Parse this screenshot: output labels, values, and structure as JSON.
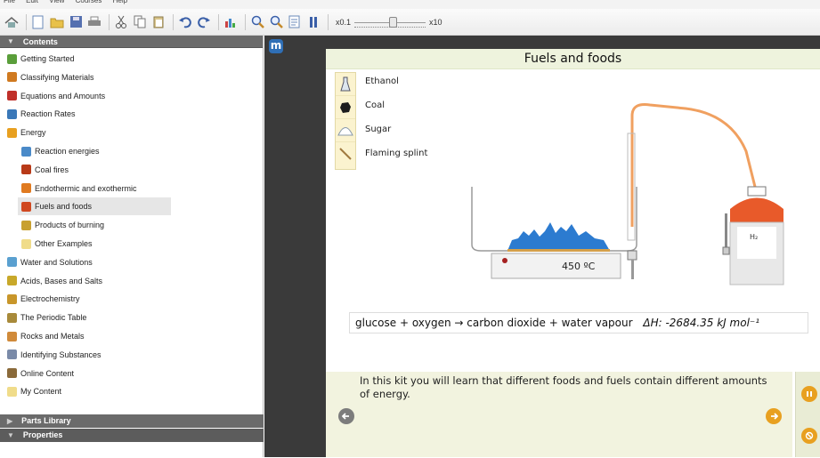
{
  "toolbar": {
    "speed_min_label": "x0.1",
    "speed_max_label": "x10",
    "speed_value_fraction": 0.55
  },
  "sidebar": {
    "contents_header": "Contents",
    "items": [
      {
        "label": "Getting Started",
        "icon": "getting-started-icon",
        "indent": 0
      },
      {
        "label": "Classifying Materials",
        "icon": "classifying-icon",
        "indent": 0
      },
      {
        "label": "Equations and Amounts",
        "icon": "equations-icon",
        "indent": 0
      },
      {
        "label": "Reaction Rates",
        "icon": "rates-icon",
        "indent": 0
      },
      {
        "label": "Energy",
        "icon": "energy-icon",
        "indent": 0
      },
      {
        "label": "Reaction energies",
        "icon": "reaction-energies-icon",
        "indent": 1
      },
      {
        "label": "Coal fires",
        "icon": "coal-fires-icon",
        "indent": 1
      },
      {
        "label": "Endothermic and exothermic",
        "icon": "endothermic-icon",
        "indent": 1
      },
      {
        "label": "Fuels and foods",
        "icon": "fuels-icon",
        "indent": 1,
        "selected": true
      },
      {
        "label": "Products of burning",
        "icon": "products-icon",
        "indent": 1
      },
      {
        "label": "Other Examples",
        "icon": "folder-icon",
        "indent": 1
      },
      {
        "label": "Water and Solutions",
        "icon": "water-icon",
        "indent": 0
      },
      {
        "label": "Acids, Bases and Salts",
        "icon": "acids-icon",
        "indent": 0
      },
      {
        "label": "Electrochemistry",
        "icon": "electro-icon",
        "indent": 0
      },
      {
        "label": "The Periodic Table",
        "icon": "periodic-icon",
        "indent": 0
      },
      {
        "label": "Rocks and Metals",
        "icon": "rocks-icon",
        "indent": 0
      },
      {
        "label": "Identifying Substances",
        "icon": "identify-icon",
        "indent": 0
      },
      {
        "label": "Online Content",
        "icon": "online-icon",
        "indent": 0
      },
      {
        "label": "My Content",
        "icon": "folder-icon",
        "indent": 0
      }
    ],
    "parts_library_header": "Parts Library",
    "properties_header": "Properties"
  },
  "main": {
    "title": "Fuels and foods",
    "parts": [
      "Ethanol",
      "Coal",
      "Sugar",
      "Flaming splint"
    ],
    "temperature": "450 ºC",
    "gas_label": "H₂",
    "equation": "glucose + oxygen → carbon dioxide + water vapour",
    "delta_h": "ΔH: -2684.35 kJ mol⁻¹",
    "info": "In this kit you will learn that different foods and fuels contain different amounts of energy."
  }
}
